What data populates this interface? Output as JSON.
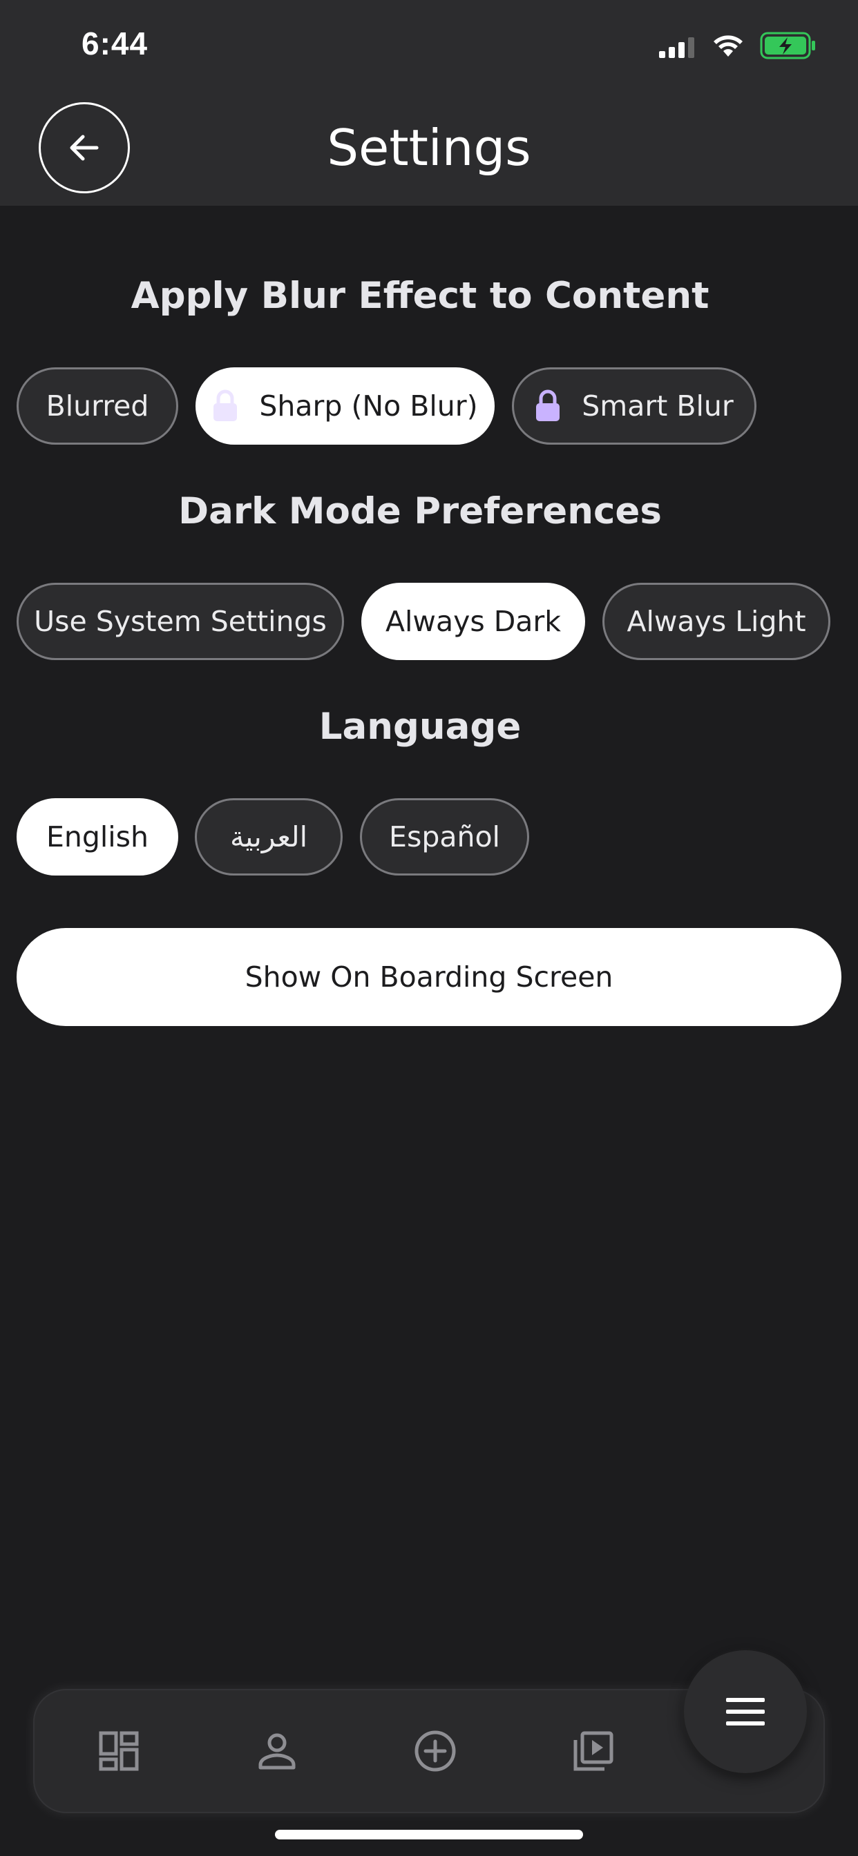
{
  "status_bar": {
    "time": "6:44"
  },
  "header": {
    "title": "Settings"
  },
  "blur": {
    "title": "Apply Blur Effect to Content",
    "options": [
      "Blurred",
      "Sharp (No Blur)",
      "Smart Blur"
    ],
    "selected": "Sharp (No Blur)"
  },
  "dark_mode": {
    "title": "Dark Mode Preferences",
    "options": [
      "Use System Settings",
      "Always Dark",
      "Always Light"
    ],
    "selected": "Always Dark"
  },
  "language": {
    "title": "Language",
    "options": [
      "English",
      "العربية",
      "Español"
    ],
    "selected": "English"
  },
  "onboarding_button": "Show On Boarding Screen",
  "tabbar": {
    "icons": [
      "dashboard-icon",
      "profile-icon",
      "add-circle-icon",
      "video-library-icon"
    ]
  },
  "menu_fab_icon": "hamburger-menu-icon",
  "colors": {
    "background": "#1c1c1e",
    "header": "#2c2c2e",
    "lock_accent": "#c9b3ff",
    "battery": "#34c759"
  }
}
